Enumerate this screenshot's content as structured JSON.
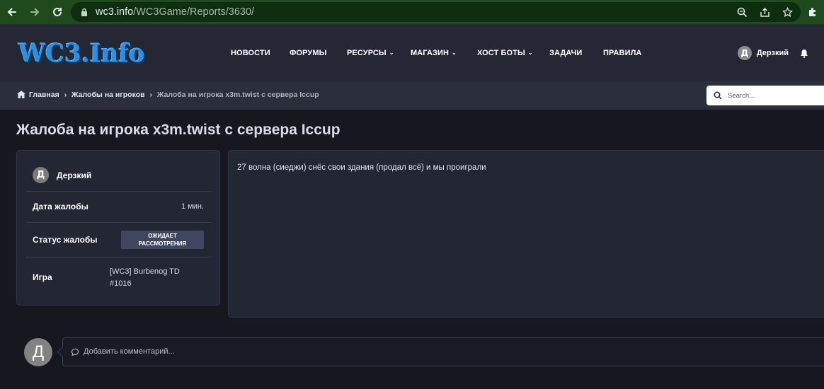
{
  "browser": {
    "url_host": "wc3.info",
    "url_path": "/WC3Game/Reports/3630/",
    "icons": [
      "back-icon",
      "forward-icon",
      "reload-icon",
      "lock-icon",
      "zoom-icon",
      "share-icon",
      "bookmark-star-icon",
      "extensions-puzzle-icon"
    ]
  },
  "site": {
    "logo_text": "WC3.Info",
    "nav": [
      {
        "label": "НОВОСТИ",
        "has_dropdown": false
      },
      {
        "label": "ФОРУМЫ",
        "has_dropdown": false
      },
      {
        "label": "РЕСУРСЫ",
        "has_dropdown": true
      },
      {
        "label": "МАГАЗИН",
        "has_dropdown": true
      },
      {
        "label": "ХОСТ БОТЫ",
        "has_dropdown": true
      },
      {
        "label": "ЗАДАЧИ",
        "has_dropdown": false
      },
      {
        "label": "ПРАВИЛА",
        "has_dropdown": false
      }
    ],
    "user": {
      "initial": "Д",
      "name": "Дерзкий"
    }
  },
  "breadcrumb": {
    "items": [
      "Главная",
      "Жалобы на игроков",
      "Жалоба на игрока x3m.twist с сервера Iccup"
    ]
  },
  "search": {
    "placeholder": "Search..."
  },
  "page": {
    "title": "Жалоба на игрока x3m.twist с сервера Iccup"
  },
  "report": {
    "author_initial": "Д",
    "author_name": "Дерзкий",
    "date_label": "Дата жалобы",
    "date_value": "1 мин.",
    "status_label": "Статус жалобы",
    "status_line1": "ОЖИДАЕТ",
    "status_line2": "РАССМОТРЕНИЯ",
    "game_label": "Игра",
    "game_line1": "[WC3] Burbenog TD",
    "game_line2": "#1016",
    "body": "27 волна (сиеджи) снёс свои здания (продал всё) и мы проиграли"
  },
  "comment": {
    "avatar_initial": "Д",
    "placeholder": "Добавить комментарий..."
  },
  "colors": {
    "accent": "#2f8ee0",
    "header_bg": "#252834",
    "body_bg": "#16171f",
    "badge_bg": "#3f4660"
  }
}
